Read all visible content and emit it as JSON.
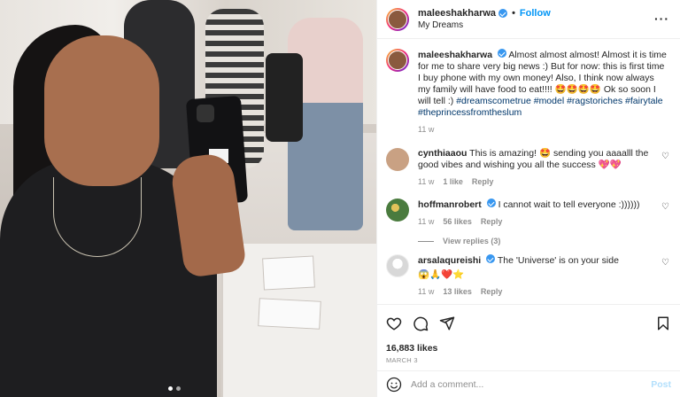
{
  "post": {
    "username": "maleeshakharwa",
    "follow_label": "Follow",
    "location": "My Dreams",
    "more_icon": "more-horizontal-icon",
    "carousel_count": 2
  },
  "caption": {
    "username": "maleeshakharwa",
    "text": "Almost almost almost! Almost it is time for me to share very big news :) But for now: this is first time I buy phone with my own money! Also, I think now always my family will have food to eat!!!! 🤩🤩🤩🤩 Ok so soon I will tell :)",
    "hashtags": "#dreamscometrue #model #ragstoriches #fairytale #theprincessfromtheslum",
    "time": "11 w"
  },
  "comments": [
    {
      "username": "cynthiaaou",
      "text": "This is amazing! 🤩 sending you aaaalll the good vibes and wishing you all the success 💖💖",
      "time": "11 w",
      "likes": "1 like",
      "reply": "Reply",
      "avatar_color": "#c9a183",
      "verified": false
    },
    {
      "username": "hoffmanrobert",
      "text": "I cannot wait to tell everyone :))))))",
      "time": "11 w",
      "likes": "56 likes",
      "reply": "Reply",
      "avatar_color": "#4a7b3e",
      "verified": true,
      "view_replies": "View replies (3)"
    },
    {
      "username": "arsalaqureishi",
      "text": "The 'Universe' is on your side",
      "extra": "😱🙏❤️⭐",
      "time": "11 w",
      "likes": "13 likes",
      "reply": "Reply",
      "avatar_color": "#d8d8d8",
      "verified": true
    }
  ],
  "actions": {
    "likes": "16,883 likes",
    "date": "MARCH 3"
  },
  "add_comment": {
    "placeholder": "Add a comment...",
    "post_label": "Post"
  },
  "colors": {
    "link": "#0095f6",
    "hashtag": "#00376b",
    "muted": "#8e8e8e",
    "verified": "#3897f0"
  }
}
